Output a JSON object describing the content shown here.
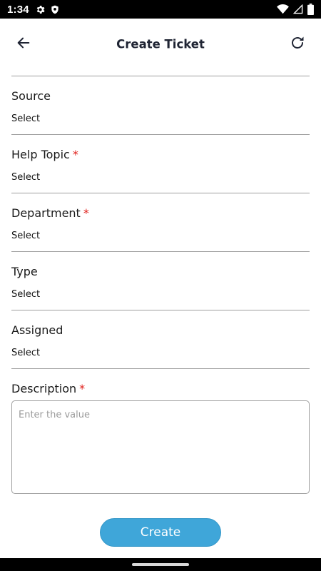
{
  "status_bar": {
    "time": "1:34",
    "left_icons": [
      "gear-icon",
      "shield-icon"
    ],
    "right_icons": [
      "wifi-icon",
      "signal-icon",
      "battery-icon"
    ]
  },
  "app_bar": {
    "title": "Create Ticket",
    "back_icon": "arrow-left-icon",
    "refresh_icon": "refresh-icon"
  },
  "form": {
    "source": {
      "label": "Source",
      "value": "Select",
      "required": false
    },
    "help_topic": {
      "label": "Help Topic",
      "value": "Select",
      "required": true
    },
    "department": {
      "label": "Department",
      "value": "Select",
      "required": true
    },
    "type": {
      "label": "Type",
      "value": "Select",
      "required": false
    },
    "assigned": {
      "label": "Assigned",
      "value": "Select",
      "required": false
    },
    "description": {
      "label": "Description",
      "required": true,
      "value": "",
      "placeholder": "Enter the value"
    },
    "required_marker": "*"
  },
  "actions": {
    "create_label": "Create"
  },
  "colors": {
    "accent": "#3fa6d9",
    "required": "#e0201b",
    "divider": "#9e9e9e"
  }
}
